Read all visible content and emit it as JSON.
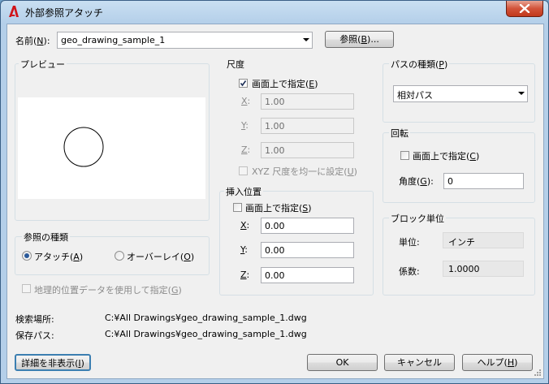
{
  "window": {
    "title": "外部参照アタッチ",
    "close_glyph": "✕"
  },
  "name_field": {
    "label": "名前(",
    "key": "N",
    "label_end": "):",
    "value": "geo_drawing_sample_1"
  },
  "browse_button": {
    "label": "参照(",
    "key": "B",
    "label_end": ")..."
  },
  "preview": {
    "title": "プレビュー"
  },
  "reference_type": {
    "title": "参照の種類",
    "attach": {
      "label": "アタッチ(",
      "key": "A",
      "end": ")",
      "selected": true
    },
    "overlay": {
      "label": "オーバーレイ(",
      "key": "O",
      "end": ")",
      "selected": false
    }
  },
  "geo_checkbox": {
    "label": "地理的位置データを使用して指定(",
    "key": "G",
    "end": ")"
  },
  "scale": {
    "title": "尺度",
    "specify": {
      "label": "画面上で指定(",
      "key": "E",
      "end": ")",
      "checked": true
    },
    "x": {
      "key": "X",
      "end": ":",
      "value": "1.00"
    },
    "y": {
      "key": "Y",
      "end": ":",
      "value": "1.00"
    },
    "z": {
      "key": "Z",
      "end": ":",
      "value": "1.00"
    },
    "uniform": {
      "label": "XYZ 尺度を均一に設定(",
      "key": "U",
      "end": ")"
    }
  },
  "insertion": {
    "title": "挿入位置",
    "specify": {
      "label": "画面上で指定(",
      "key": "S",
      "end": ")",
      "checked": false
    },
    "x": {
      "key": "X",
      "end": ":",
      "value": "0.00"
    },
    "y": {
      "key": "Y",
      "end": ":",
      "value": "0.00"
    },
    "z": {
      "key": "Z",
      "end": ":",
      "value": "0.00"
    }
  },
  "path_type": {
    "title": "パスの種類(",
    "key": "P",
    "end": ")",
    "value": "相対パス"
  },
  "rotation": {
    "title": "回転",
    "specify": {
      "label": "画面上で指定(",
      "key": "C",
      "end": ")",
      "checked": false
    },
    "angle": {
      "label": "角度(",
      "key": "G",
      "end": "):",
      "value": "0"
    }
  },
  "block_unit": {
    "title": "ブロック単位",
    "unit_label": "単位:",
    "unit_value": "インチ",
    "factor_label": "係数:",
    "factor_value": "1.0000"
  },
  "found_in": {
    "label": "検索場所:",
    "value": "C:¥All Drawings¥geo_drawing_sample_1.dwg"
  },
  "saved_path": {
    "label": "保存パス:",
    "value": "C:¥All Drawings¥geo_drawing_sample_1.dwg"
  },
  "buttons": {
    "details": {
      "label": "詳細を非表示(",
      "key": "I",
      "end": ")"
    },
    "ok": "OK",
    "cancel": "キャンセル",
    "help": {
      "label": "ヘルプ(",
      "key": "H",
      "end": ")"
    }
  }
}
